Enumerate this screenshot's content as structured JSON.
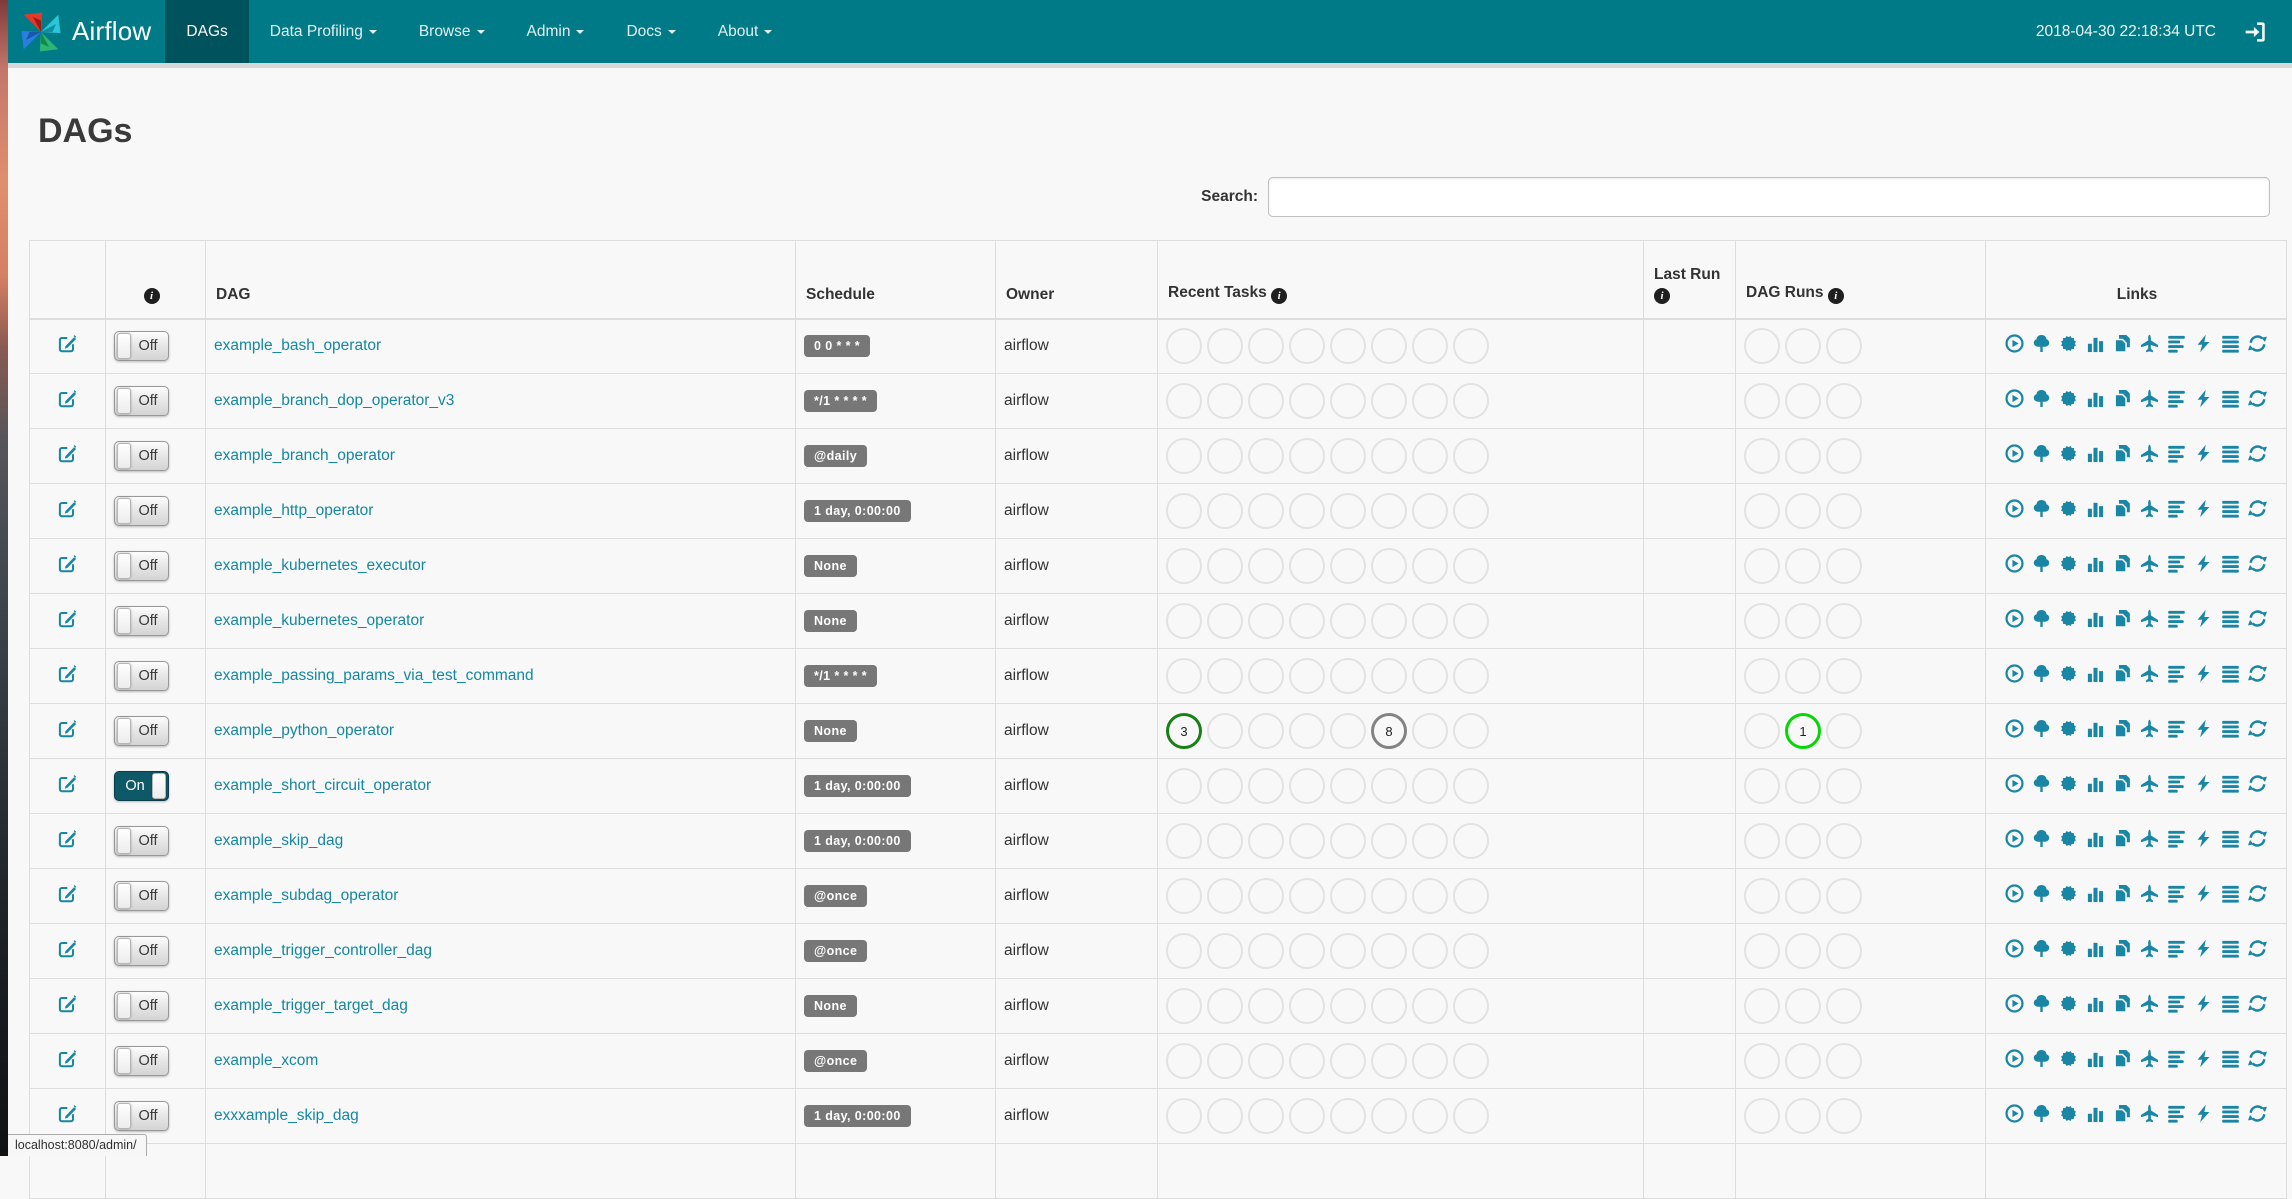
{
  "navbar": {
    "brand": "Airflow",
    "items": [
      {
        "label": "DAGs",
        "active": true,
        "caret": false
      },
      {
        "label": "Data Profiling",
        "active": false,
        "caret": true
      },
      {
        "label": "Browse",
        "active": false,
        "caret": true
      },
      {
        "label": "Admin",
        "active": false,
        "caret": true
      },
      {
        "label": "Docs",
        "active": false,
        "caret": true
      },
      {
        "label": "About",
        "active": false,
        "caret": true
      }
    ],
    "clock": "2018-04-30 22:18:34 UTC",
    "signout_icon": "sign-out-icon"
  },
  "page": {
    "title": "DAGs",
    "search_label": "Search:",
    "search_value": ""
  },
  "colors": {
    "navbar_bg": "#007a87",
    "navbar_active_bg": "#00525c",
    "link_teal": "#1587a0",
    "icon_teal": "#1a86a5",
    "badge_gray": "#777777",
    "toggle_on_bg": "#0e5968",
    "circle_success_green": "#178117",
    "circle_queued_gray": "#838383",
    "circle_running_lime": "#06d606",
    "circle_empty_border": "#e2e2e2"
  },
  "table": {
    "headers": {
      "edit": "",
      "info_icon": "i",
      "dag": "DAG",
      "schedule": "Schedule",
      "owner": "Owner",
      "recent_tasks": "Recent Tasks",
      "last_run": "Last Run",
      "dag_runs": "DAG Runs",
      "links": "Links"
    },
    "recent_tasks_circle_count": 8,
    "dag_runs_circle_count": 3,
    "links_icons": [
      {
        "name": "trigger-dag-play-circle-icon",
        "sym": "sym-play-circle"
      },
      {
        "name": "tree-view-icon",
        "sym": "sym-tree"
      },
      {
        "name": "graph-view-sunburst-icon",
        "sym": "sym-certificate"
      },
      {
        "name": "task-duration-chart-icon",
        "sym": "sym-stats"
      },
      {
        "name": "task-tries-duplicate-icon",
        "sym": "sym-duplicate"
      },
      {
        "name": "landing-times-plane-icon",
        "sym": "sym-plane"
      },
      {
        "name": "gantt-view-align-left-icon",
        "sym": "sym-align-left"
      },
      {
        "name": "code-view-flash-icon",
        "sym": "sym-flash"
      },
      {
        "name": "logs-align-justify-icon",
        "sym": "sym-align-justify"
      },
      {
        "name": "refresh-dag-icon",
        "sym": "sym-refresh"
      }
    ],
    "rows": [
      {
        "name": "example_bash_operator",
        "toggle": "Off",
        "schedule": "0 0 * * *",
        "owner": "airflow",
        "recent_tasks": [],
        "last_run": "",
        "dag_runs": []
      },
      {
        "name": "example_branch_dop_operator_v3",
        "toggle": "Off",
        "schedule": "*/1 * * * *",
        "owner": "airflow",
        "recent_tasks": [],
        "last_run": "",
        "dag_runs": []
      },
      {
        "name": "example_branch_operator",
        "toggle": "Off",
        "schedule": "@daily",
        "owner": "airflow",
        "recent_tasks": [],
        "last_run": "",
        "dag_runs": []
      },
      {
        "name": "example_http_operator",
        "toggle": "Off",
        "schedule": "1 day, 0:00:00",
        "owner": "airflow",
        "recent_tasks": [],
        "last_run": "",
        "dag_runs": []
      },
      {
        "name": "example_kubernetes_executor",
        "toggle": "Off",
        "schedule": "None",
        "owner": "airflow",
        "recent_tasks": [],
        "last_run": "",
        "dag_runs": []
      },
      {
        "name": "example_kubernetes_operator",
        "toggle": "Off",
        "schedule": "None",
        "owner": "airflow",
        "recent_tasks": [],
        "last_run": "",
        "dag_runs": []
      },
      {
        "name": "example_passing_params_via_test_command",
        "toggle": "Off",
        "schedule": "*/1 * * * *",
        "owner": "airflow",
        "recent_tasks": [],
        "last_run": "",
        "dag_runs": []
      },
      {
        "name": "example_python_operator",
        "toggle": "Off",
        "schedule": "None",
        "owner": "airflow",
        "recent_tasks": [
          {
            "pos": 0,
            "count": "3",
            "color": "circle_success_green"
          },
          {
            "pos": 5,
            "count": "8",
            "color": "circle_queued_gray"
          }
        ],
        "last_run": "",
        "dag_runs": [
          {
            "pos": 1,
            "count": "1",
            "color": "circle_running_lime"
          }
        ]
      },
      {
        "name": "example_short_circuit_operator",
        "toggle": "On",
        "schedule": "1 day, 0:00:00",
        "owner": "airflow",
        "recent_tasks": [],
        "last_run": "",
        "dag_runs": []
      },
      {
        "name": "example_skip_dag",
        "toggle": "Off",
        "schedule": "1 day, 0:00:00",
        "owner": "airflow",
        "recent_tasks": [],
        "last_run": "",
        "dag_runs": []
      },
      {
        "name": "example_subdag_operator",
        "toggle": "Off",
        "schedule": "@once",
        "owner": "airflow",
        "recent_tasks": [],
        "last_run": "",
        "dag_runs": []
      },
      {
        "name": "example_trigger_controller_dag",
        "toggle": "Off",
        "schedule": "@once",
        "owner": "airflow",
        "recent_tasks": [],
        "last_run": "",
        "dag_runs": []
      },
      {
        "name": "example_trigger_target_dag",
        "toggle": "Off",
        "schedule": "None",
        "owner": "airflow",
        "recent_tasks": [],
        "last_run": "",
        "dag_runs": []
      },
      {
        "name": "example_xcom",
        "toggle": "Off",
        "schedule": "@once",
        "owner": "airflow",
        "recent_tasks": [],
        "last_run": "",
        "dag_runs": []
      },
      {
        "name": "exxxample_skip_dag",
        "toggle": "Off",
        "schedule": "1 day, 0:00:00",
        "owner": "airflow",
        "recent_tasks": [],
        "last_run": "",
        "dag_runs": []
      }
    ]
  },
  "status_bar": {
    "text": "localhost:8080/admin/"
  }
}
